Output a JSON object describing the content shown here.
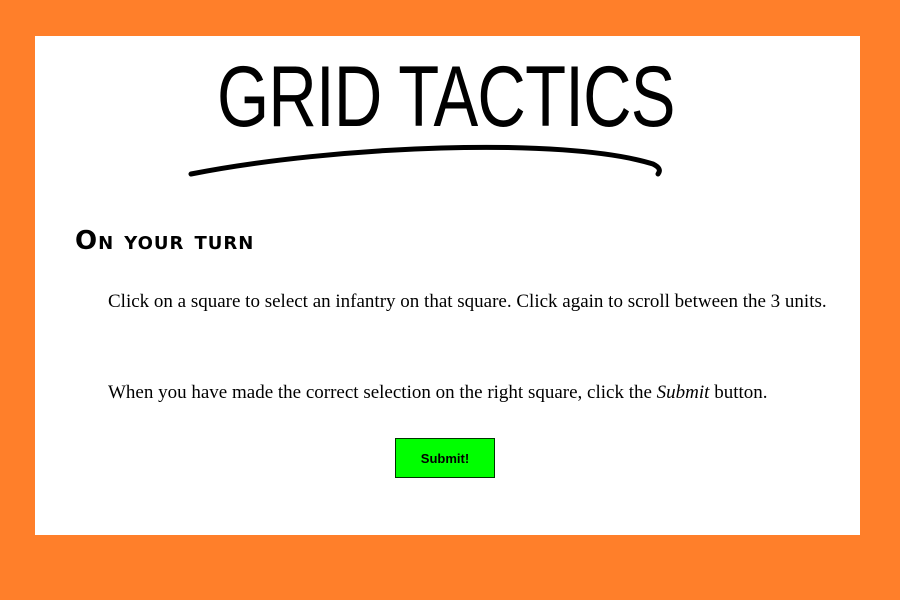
{
  "colors": {
    "frame_background": "#ff7f2a",
    "panel_background": "#ffffff",
    "submit_button": "#00ff00"
  },
  "logo": {
    "title": "GRID TACTICS"
  },
  "instructions": {
    "heading": "On your turn",
    "paragraph1": "Click on a square to select an infantry on that square. Click again to scroll between the 3 units.",
    "paragraph2_before": "When you have made the correct selection on the right square, click the ",
    "paragraph2_emphasis": "Submit",
    "paragraph2_after": " button."
  },
  "submit": {
    "label": "Submit!"
  }
}
